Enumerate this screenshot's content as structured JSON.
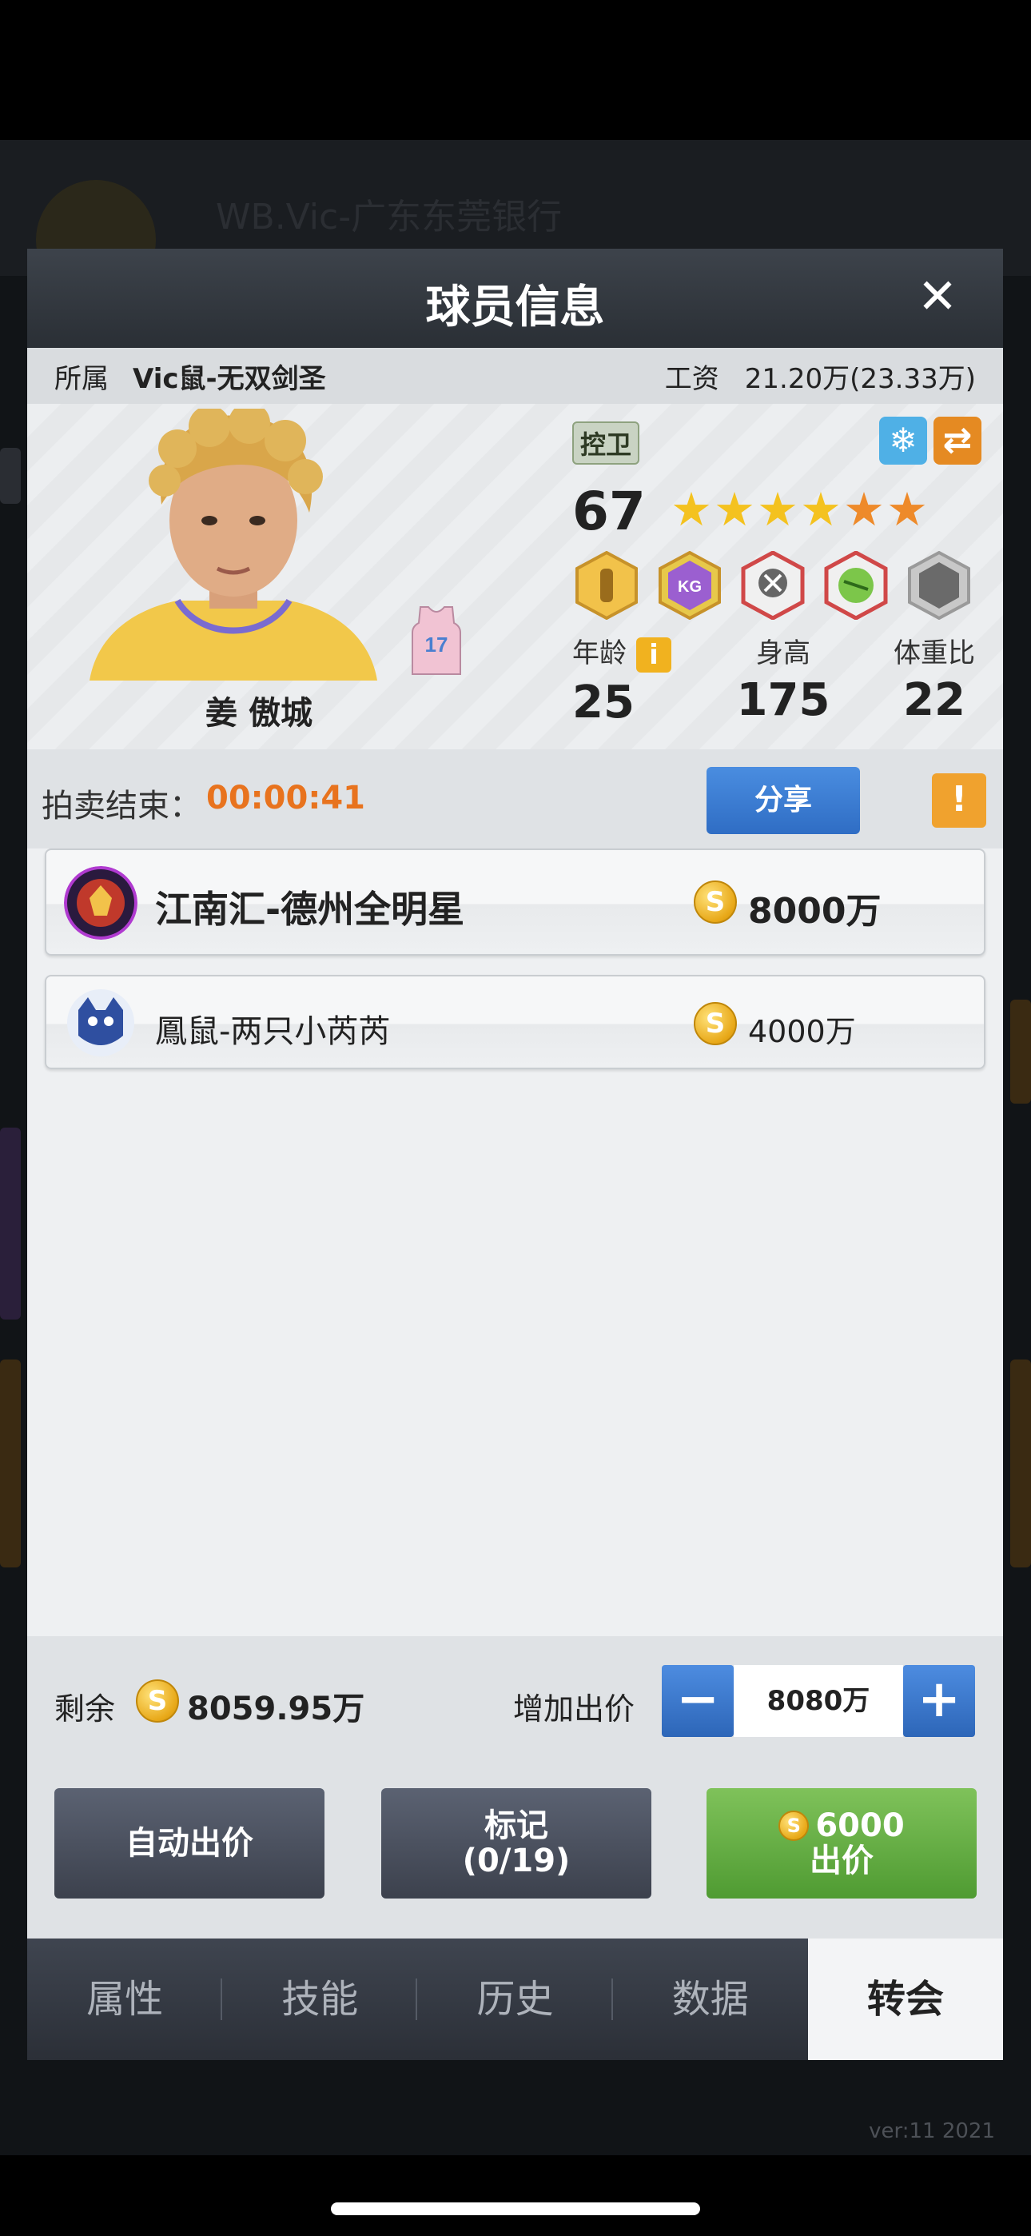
{
  "background": {
    "header_title": "WB.Vic-广东东莞银行",
    "tabs": [
      "",
      "",
      "",
      "",
      ""
    ],
    "version": "ver:11  2021"
  },
  "modal": {
    "title": "球员信息",
    "close_label": "✕"
  },
  "info_bar": {
    "team_label": "所属",
    "team_value": "Vic鼠-无双剑圣",
    "salary_label": "工资",
    "salary_value": "21.20万(23.33万)"
  },
  "player": {
    "name": "姜 傲城",
    "jersey_number": "17",
    "position": "控卫",
    "rating": "67",
    "stars_gold": 4,
    "stars_orange": 2,
    "age_label": "年龄",
    "age": "25",
    "height_label": "身高",
    "height": "175",
    "weight_ratio_label": "体重比",
    "weight_ratio": "22",
    "info_icon": "i",
    "freeze_icon": "snowflake-icon",
    "swap_icon": "swap-icon",
    "skill_badges": [
      "gold-body-badge",
      "purple-kg-badge",
      "red-blocked-badge",
      "green-ball-badge",
      "gray-empty-badge"
    ],
    "kg_text": "KG"
  },
  "auction": {
    "label": "拍卖结束：",
    "time": "00:00:41",
    "share_label": "分享",
    "warn_icon": "!"
  },
  "bids": [
    {
      "team": "江南汇-德州全明星",
      "amount": "8000万",
      "coin": "S"
    },
    {
      "team": "鳳鼠-两只小芮芮",
      "amount": "4000万",
      "coin": "S"
    }
  ],
  "bottom": {
    "remain_label": "剩余",
    "remain_amount": "8059.95万",
    "raise_label": "增加出价",
    "minus": "−",
    "plus": "+",
    "raise_value": "8080万",
    "auto_bid_label": "自动出价",
    "mark_label": "标记",
    "mark_count": "(0/19)",
    "bid_amount": "6000",
    "bid_label": "出价",
    "coin": "S"
  },
  "tabs": [
    {
      "label": "属性",
      "active": false
    },
    {
      "label": "技能",
      "active": false
    },
    {
      "label": "历史",
      "active": false
    },
    {
      "label": "数据",
      "active": false
    },
    {
      "label": "转会",
      "active": true
    }
  ],
  "colors": {
    "accent_orange": "#e8731e",
    "share_blue": "#2f6dc4",
    "bid_green": "#4f9b32",
    "header_dark": "#2a2f35"
  }
}
